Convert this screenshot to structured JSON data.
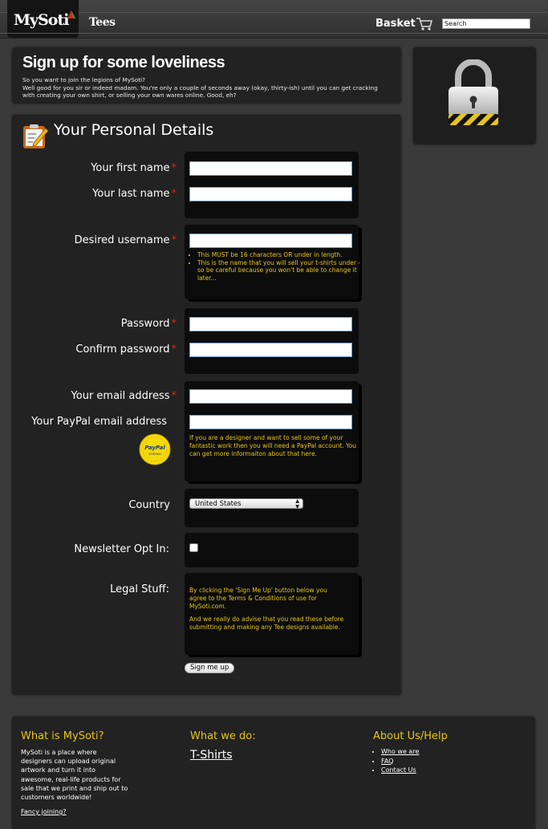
{
  "header": {
    "logo_text": "MySoti",
    "nav_tees": "Tees",
    "basket_label": "Basket",
    "search_placeholder": "Search"
  },
  "intro": {
    "title": "Sign up for some loveliness",
    "line1": "So you want to join the legions of MySoti?",
    "line2": "Well good for you sir or indeed madam. You're only a couple of seconds away (okay, thirty-ish) until you can get cracking with creating your own shirt, or selling your own wares online. Good, eh?"
  },
  "form": {
    "section_title": "Your Personal Details",
    "first_name_label": "Your first name",
    "last_name_label": "Your last name",
    "username_label": "Desired username",
    "username_hints": [
      "This MUST be 16 characters OR under in length.",
      "This is the name that you will sell your t-shirts under - so be careful because you won't be able to change it later..."
    ],
    "password_label": "Password",
    "confirm_password_label": "Confirm password",
    "email_label": "Your email address",
    "paypal_label": "Your PayPal email address",
    "paypal_badge_text": "PayPal VERIFIED",
    "paypal_note": "If you are a designer and want to sell some of your fantastic work then you will need a PayPal account. You can get more informaiton about that here.",
    "country_label": "Country",
    "country_value": "United States",
    "newsletter_label": "Newsletter Opt In:",
    "legal_label": "Legal Stuff:",
    "legal_text1": "By clicking the 'Sign Me Up' button below you agree to the Terms & Conditions of use for MySoti.com.",
    "legal_text2": "And we really do advise that you read these before submitting and making any Tee designs available.",
    "required_mark": "*",
    "submit_label": "Sign me up"
  },
  "footer": {
    "what_is_title": "What is MySoti?",
    "what_is_text": "MySoti is a place where designers can upload original artwork and turn it into awesome, real-life products for sale that we print and ship out to customers worldwide!",
    "fancy_joining": "Fancy joining?",
    "what_we_do_title": "What we do:",
    "tshirts_link": "T-Shirts",
    "about_title": "About Us/Help",
    "about_links": [
      "Who we are",
      "FAQ",
      "Contact Us"
    ]
  },
  "colors": {
    "accent_yellow": "#e6c51a",
    "required_red": "#dd2222",
    "panel_bg": "#222222",
    "page_bg": "#3a3a3a"
  }
}
